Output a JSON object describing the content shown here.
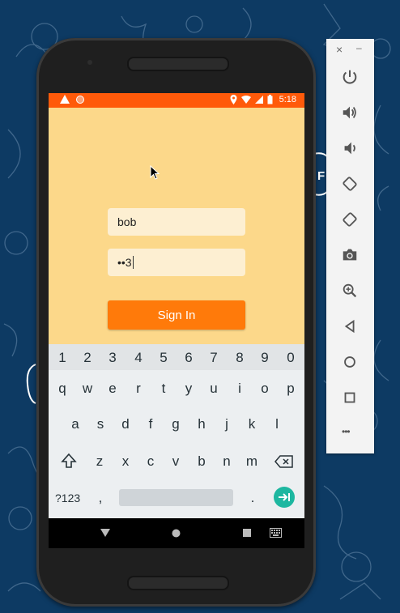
{
  "status_bar": {
    "time": "5:18"
  },
  "form": {
    "username_value": "bob",
    "password_value": "••3",
    "signin_label": "Sign In"
  },
  "keyboard": {
    "number_row": [
      "1",
      "2",
      "3",
      "4",
      "5",
      "6",
      "7",
      "8",
      "9",
      "0"
    ],
    "row1": [
      "q",
      "w",
      "e",
      "r",
      "t",
      "y",
      "u",
      "i",
      "o",
      "p"
    ],
    "row2": [
      "a",
      "s",
      "d",
      "f",
      "g",
      "h",
      "j",
      "k",
      "l"
    ],
    "row3": [
      "z",
      "x",
      "c",
      "v",
      "b",
      "n",
      "m"
    ],
    "symbols_label": "?123",
    "comma": ",",
    "period": "."
  },
  "emulator_panel": {
    "close": "×",
    "minimize": "–",
    "more": "•••",
    "buttons": [
      "power-icon",
      "volume-up-icon",
      "volume-down-icon",
      "rotate-left-icon",
      "rotate-right-icon",
      "camera-icon",
      "zoom-icon",
      "back-icon",
      "home-icon",
      "overview-icon",
      "more-icon"
    ]
  },
  "colors": {
    "status_bar": "#ff5a0a",
    "app_background": "#fcd88a",
    "input_background": "#fdefd2",
    "button": "#ff7a0a",
    "page_background": "#0d3a63"
  }
}
